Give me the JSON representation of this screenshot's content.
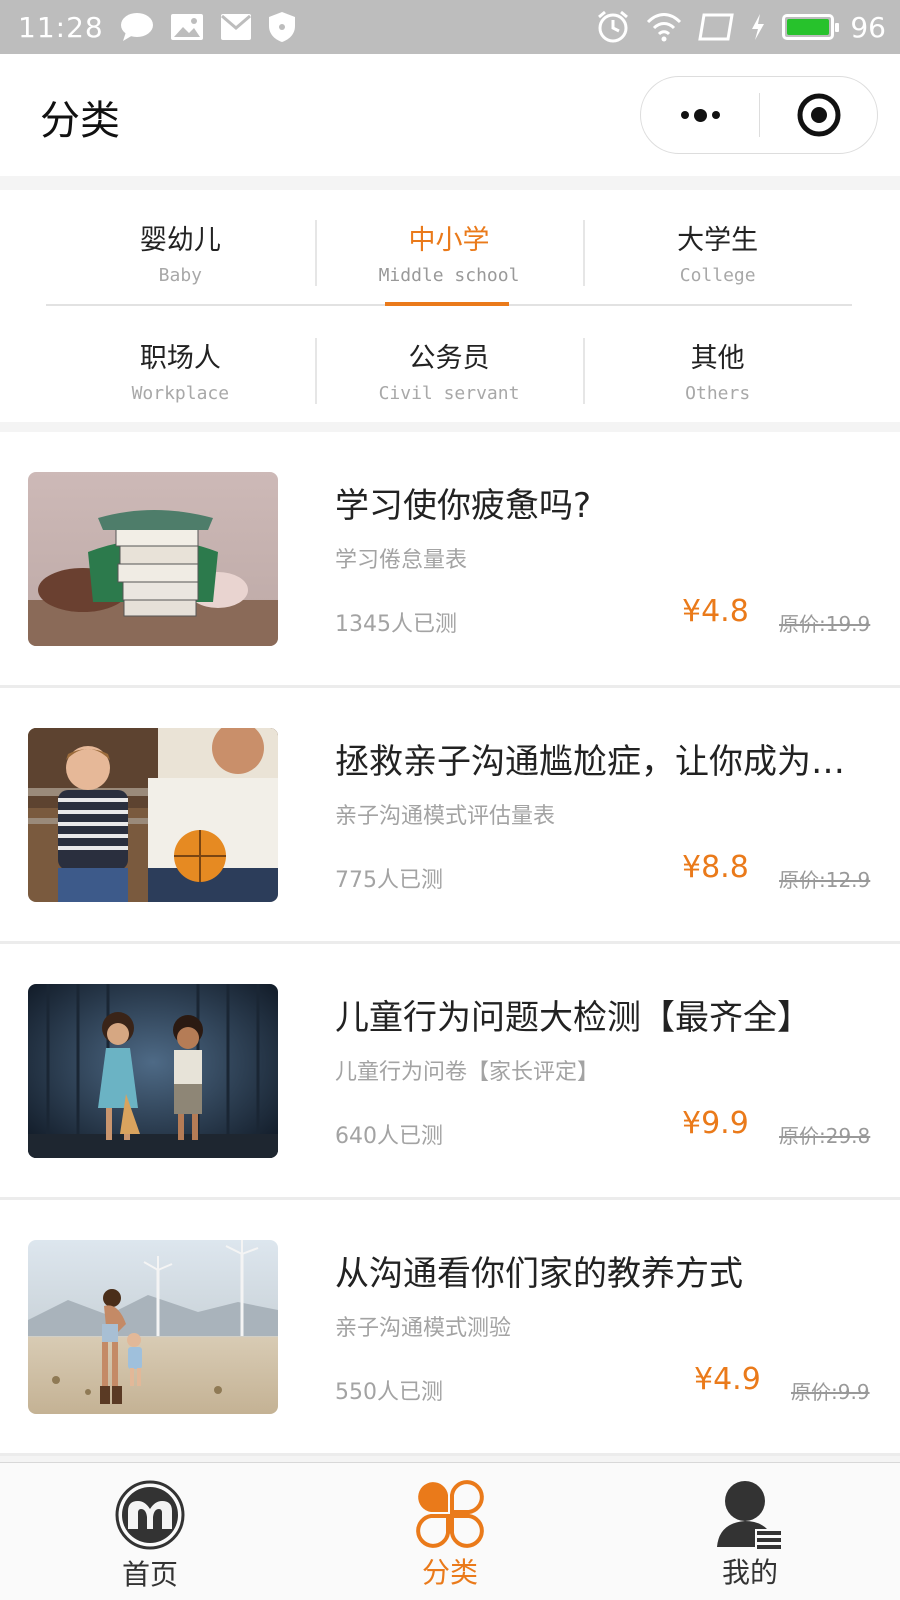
{
  "status_bar": {
    "time": "11:28",
    "battery": "96"
  },
  "header": {
    "title": "分类"
  },
  "colors": {
    "accent": "#ea7a1a",
    "battery_green": "#27c22c"
  },
  "categories": [
    {
      "cn": "婴幼儿",
      "en": "Baby",
      "active": false
    },
    {
      "cn": "中小学",
      "en": "Middle school",
      "active": true
    },
    {
      "cn": "大学生",
      "en": "College",
      "active": false
    },
    {
      "cn": "职场人",
      "en": "Workplace",
      "active": false
    },
    {
      "cn": "公务员",
      "en": "Civil servant",
      "active": false
    },
    {
      "cn": "其他",
      "en": "Others",
      "active": false
    }
  ],
  "items": [
    {
      "title": "学习使你疲惫吗?",
      "subtitle": "学习倦怠量表",
      "count": "1345人已测",
      "price": "¥4.8",
      "original": "原价:19.9",
      "image": "books-on-head"
    },
    {
      "title": "拯救亲子沟通尴尬症，让你成为…",
      "subtitle": "亲子沟通模式评估量表",
      "count": "775人已测",
      "price": "¥8.8",
      "original": "原价:12.9",
      "image": "father-and-son-with-basketball"
    },
    {
      "title": "儿童行为问题大检测【最齐全】",
      "subtitle": "儿童行为问卷【家长评定】",
      "count": "640人已测",
      "price": "¥9.9",
      "original": "原价:29.8",
      "image": "two-children"
    },
    {
      "title": "从沟通看你们家的教养方式",
      "subtitle": "亲子沟通模式测验",
      "count": "550人已测",
      "price": "¥4.9",
      "original": "原价:9.9",
      "image": "mother-and-child-desert"
    }
  ],
  "tabbar": [
    {
      "label": "首页",
      "icon": "home-m-icon",
      "active": false
    },
    {
      "label": "分类",
      "icon": "category-clover-icon",
      "active": true
    },
    {
      "label": "我的",
      "icon": "profile-icon",
      "active": false
    }
  ]
}
